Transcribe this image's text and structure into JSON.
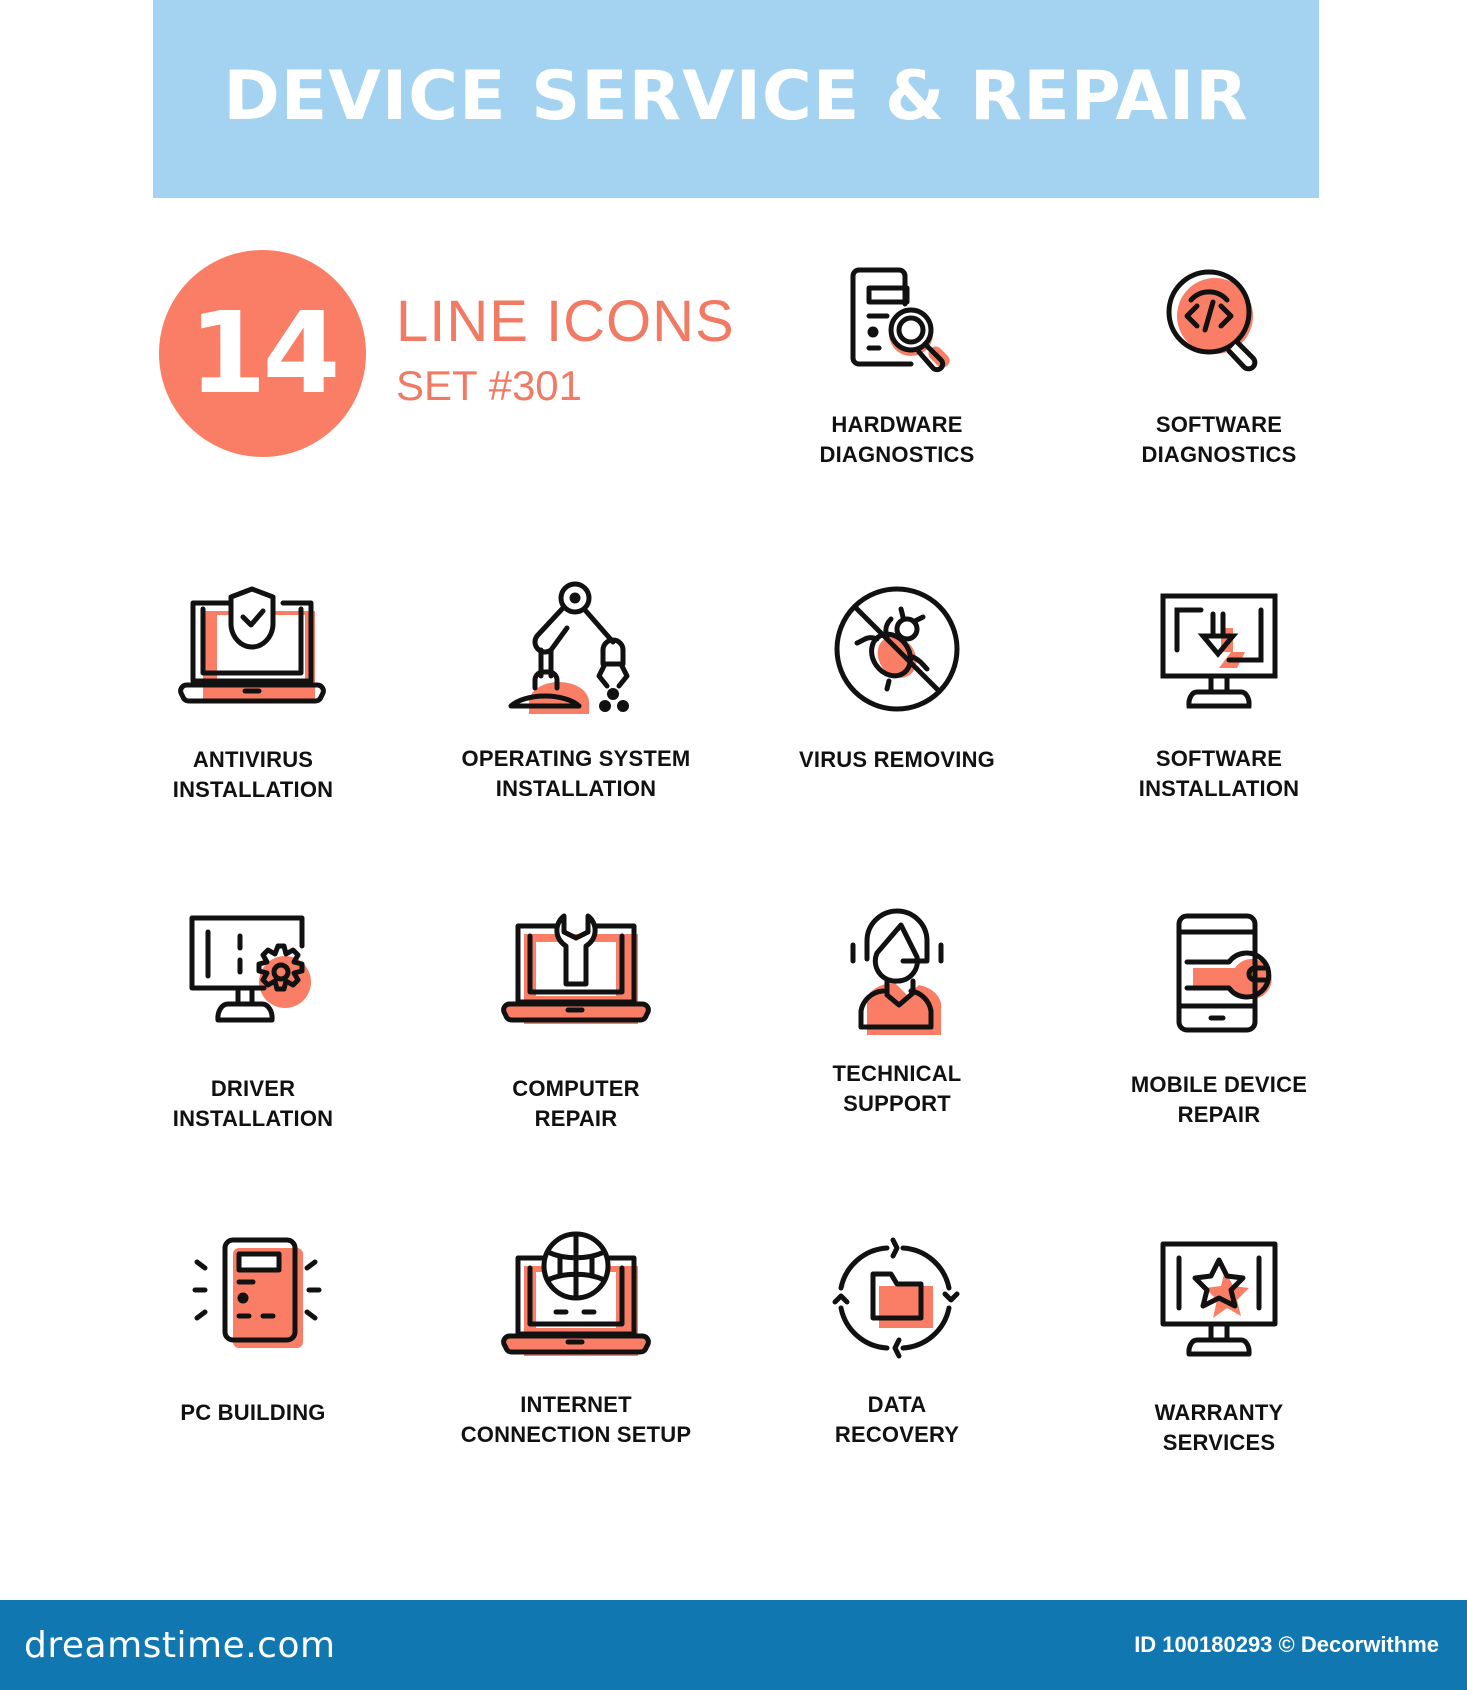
{
  "header": {
    "title": "DEVICE SERVICE & REPAIR"
  },
  "badge": {
    "count": "14",
    "title": "LINE ICONS",
    "subtitle": "SET #301"
  },
  "colors": {
    "accent": "#fa7e66",
    "banner": "#a3d3f0",
    "stroke": "#111111",
    "footer": "#1077b0"
  },
  "icons": [
    {
      "icon": "hardware-diagnostics-icon",
      "label": "HARDWARE\nDIAGNOSTICS"
    },
    {
      "icon": "software-diagnostics-icon",
      "label": "SOFTWARE\nDIAGNOSTICS"
    },
    {
      "icon": "antivirus-installation-icon",
      "label": "ANTIVIRUS\nINSTALLATION"
    },
    {
      "icon": "operating-system-installation-icon",
      "label": "OPERATING SYSTEM\nINSTALLATION"
    },
    {
      "icon": "virus-removing-icon",
      "label": "VIRUS REMOVING"
    },
    {
      "icon": "software-installation-icon",
      "label": "SOFTWARE\nINSTALLATION"
    },
    {
      "icon": "driver-installation-icon",
      "label": "DRIVER\nINSTALLATION"
    },
    {
      "icon": "computer-repair-icon",
      "label": "COMPUTER\nREPAIR"
    },
    {
      "icon": "technical-support-icon",
      "label": "TECHNICAL\nSUPPORT"
    },
    {
      "icon": "mobile-device-repair-icon",
      "label": "MOBILE DEVICE\nREPAIR"
    },
    {
      "icon": "pc-building-icon",
      "label": "PC BUILDING"
    },
    {
      "icon": "internet-connection-setup-icon",
      "label": "INTERNET\nCONNECTION SETUP"
    },
    {
      "icon": "data-recovery-icon",
      "label": "DATA\nRECOVERY"
    },
    {
      "icon": "warranty-services-icon",
      "label": "WARRANTY\nSERVICES"
    }
  ],
  "footer": {
    "logo": "dreamstime.com",
    "credit": "ID 100180293 © Decorwithme"
  }
}
